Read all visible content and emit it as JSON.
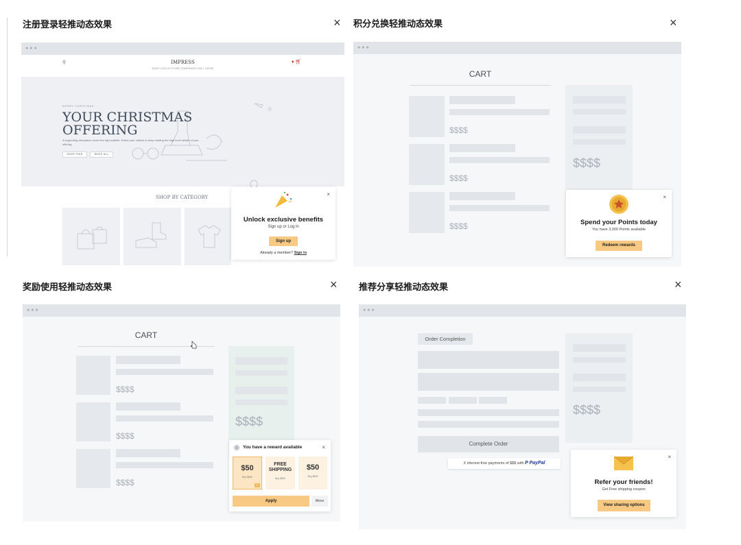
{
  "panels": [
    {
      "title": "注册登录轻推动态效果",
      "close": "×"
    },
    {
      "title": "积分兑换轻推动态效果",
      "close": "×"
    },
    {
      "title": "奖励使用轻推动态效果",
      "close": "×"
    },
    {
      "title": "推荐分享轻推动态效果",
      "close": "×"
    }
  ],
  "store": {
    "logo": "IMPRESS",
    "nav": "SHOP   COLLECTIONS   COMPANIES   SELL SHOW",
    "hero_eyebrow": "MERRY CHRISTMAS",
    "hero_line1": "YOUR CHRISTMAS",
    "hero_line2": "OFFERING",
    "hero_desc": "A supporting description under the big headline. Entice your visitors to keep reading the high level details of your offering.",
    "hero_btn1": "SHOP THIS",
    "hero_btn2": "SHOP ALL",
    "category_title": "SHOP BY CATEGORY"
  },
  "signup_popup": {
    "title": "Unlock exclusive benefits",
    "subtitle": "Sign up or Log in",
    "button": "Sign up",
    "footer_text": "Already a member?",
    "footer_link": "Sign in",
    "close": "×"
  },
  "cart": {
    "title": "CART",
    "price_placeholder": "$$$$",
    "summary_price": "$$$$"
  },
  "points_popup": {
    "title": "Spend your Points today",
    "subtitle": "You have 3,000 Points available",
    "button": "Redeem rewards",
    "close": "×"
  },
  "reward_popup": {
    "title": "You have a reward available",
    "close": "×",
    "cards": [
      {
        "amount": "$50",
        "caption": "Buy $500"
      },
      {
        "amount": "FREE SHIPPING",
        "caption": "Buy $500"
      },
      {
        "amount": "$50",
        "caption": "Buy $500"
      }
    ],
    "apply": "Apply",
    "more": "More"
  },
  "order": {
    "tag": "Order Completion",
    "button": "Complete Order",
    "paypal_text": "X interest-free payments of $$$ with",
    "paypal_brand": "PayPal",
    "summary_price": "$$$$"
  },
  "referral_popup": {
    "title": "Refer your friends!",
    "subtitle": "Get Free shipping coupon",
    "button": "View sharing options",
    "close": "×"
  },
  "colors": {
    "accent": "#f7c983",
    "frame_bg": "#f6f7f9",
    "placeholder": "#e1e5ea",
    "chrome": "#e1e4e8"
  }
}
